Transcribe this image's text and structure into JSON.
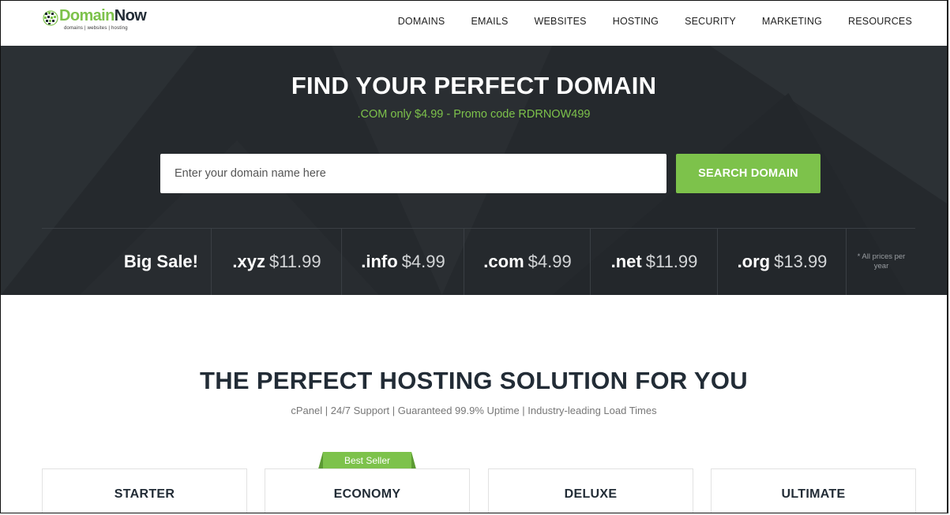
{
  "brand": {
    "name_part1": "Domain",
    "name_part2": "Now",
    "tagline": "domains | websites | hosting",
    "accent_color": "#7dc24b",
    "dark_color": "#222c36"
  },
  "nav": {
    "items": [
      "DOMAINS",
      "EMAILS",
      "WEBSITES",
      "HOSTING",
      "SECURITY",
      "MARKETING",
      "RESOURCES"
    ]
  },
  "hero": {
    "title": "FIND YOUR PERFECT DOMAIN",
    "promo": ".COM only $4.99 - Promo code RDRNOW499",
    "background_color": "#25292d"
  },
  "search": {
    "placeholder": "Enter your domain name here",
    "value": "",
    "button_label": "SEARCH DOMAIN"
  },
  "sale": {
    "label": "Big Sale!",
    "tlds": [
      {
        "tld": ".xyz",
        "price": "$11.99"
      },
      {
        "tld": ".info",
        "price": "$4.99"
      },
      {
        "tld": ".com",
        "price": "$4.99"
      },
      {
        "tld": ".net",
        "price": "$11.99"
      },
      {
        "tld": ".org",
        "price": "$13.99"
      }
    ],
    "note": "* All prices per year"
  },
  "hosting": {
    "title": "THE PERFECT HOSTING SOLUTION FOR YOU",
    "subtitle": "cPanel | 24/7 Support | Guaranteed 99.9% Uptime | Industry-leading Load Times",
    "badge": "Best Seller",
    "plans": [
      "STARTER",
      "ECONOMY",
      "DELUXE",
      "ULTIMATE"
    ]
  }
}
